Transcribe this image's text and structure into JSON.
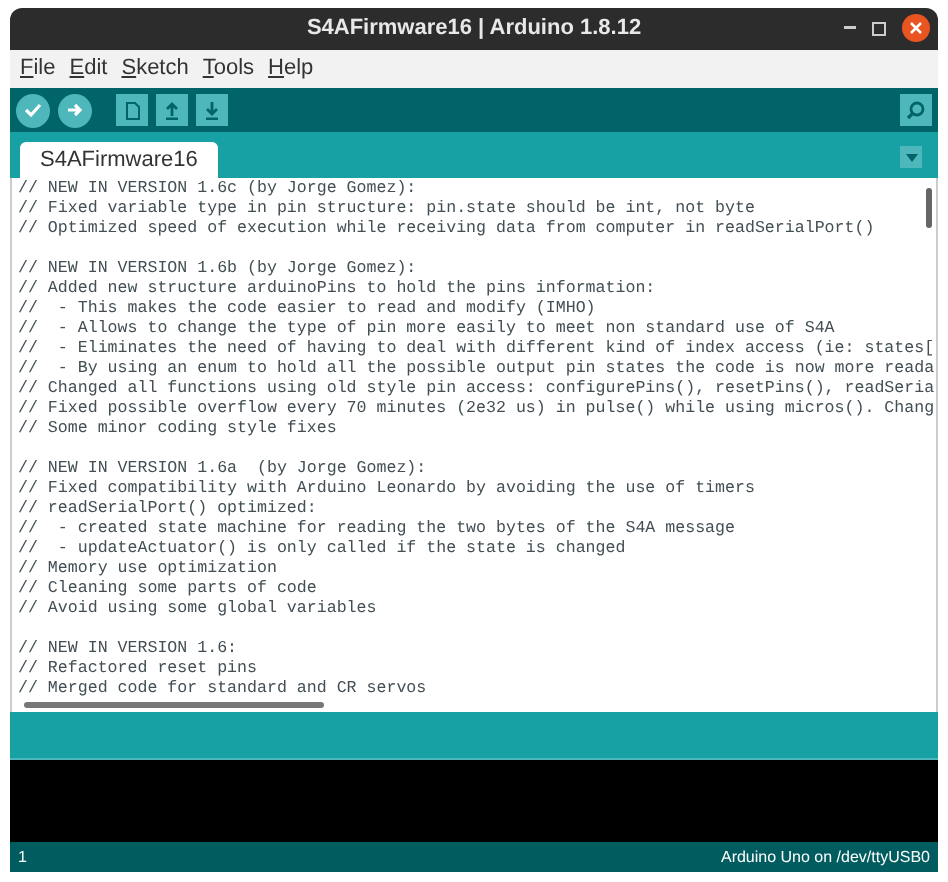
{
  "window": {
    "title": "S4AFirmware16 | Arduino 1.8.12"
  },
  "menu": [
    "File",
    "Edit",
    "Sketch",
    "Tools",
    "Help"
  ],
  "tabs": [
    {
      "label": "S4AFirmware16",
      "selected": true
    }
  ],
  "code_blocks": [
    [
      "// NEW IN VERSION 1.6c (by Jorge Gomez):",
      "// Fixed variable type in pin structure: pin.state should be int, not byte",
      "// Optimized speed of execution while receiving data from computer in readSerialPort()"
    ],
    [
      "// NEW IN VERSION 1.6b (by Jorge Gomez):",
      "// Added new structure arduinoPins to hold the pins information:",
      "//  - This makes the code easier to read and modify (IMHO)",
      "//  - Allows to change the type of pin more easily to meet non standard use of S4A",
      "//  - Eliminates the need of having to deal with different kind of index access (ie: states[",
      "//  - By using an enum to hold all the possible output pin states the code is now more reada",
      "// Changed all functions using old style pin access: configurePins(), resetPins(), readSeria",
      "// Fixed possible overflow every 70 minutes (2e32 us) in pulse() while using micros(). Chang",
      "// Some minor coding style fixes"
    ],
    [
      "// NEW IN VERSION 1.6a  (by Jorge Gomez):",
      "// Fixed compatibility with Arduino Leonardo by avoiding the use of timers",
      "// readSerialPort() optimized:",
      "//  - created state machine for reading the two bytes of the S4A message",
      "//  - updateActuator() is only called if the state is changed",
      "// Memory use optimization",
      "// Cleaning some parts of code",
      "// Avoid using some global variables"
    ],
    [
      "// NEW IN VERSION 1.6:",
      "// Refactored reset pins",
      "// Merged code for standard and CR servos"
    ]
  ],
  "status_bar": {
    "line": "1",
    "board": "Arduino Uno on /dev/ttyUSB0"
  }
}
